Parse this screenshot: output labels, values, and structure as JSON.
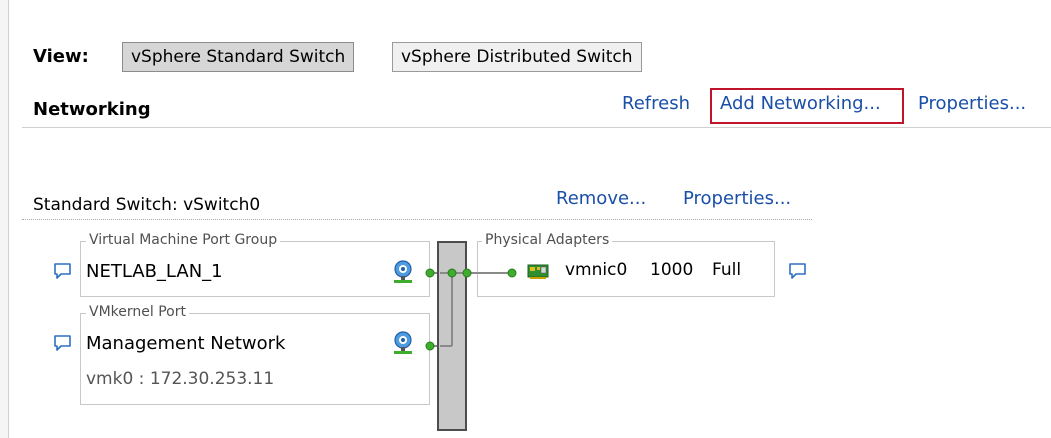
{
  "view": {
    "label": "View:",
    "buttons": [
      {
        "label": "vSphere Standard Switch",
        "active": true
      },
      {
        "label": "vSphere Distributed Switch",
        "active": false
      }
    ]
  },
  "networking": {
    "title": "Networking",
    "links": {
      "refresh": "Refresh",
      "add_networking": "Add Networking...",
      "properties": "Properties..."
    }
  },
  "standard_switch": {
    "title": "Standard Switch: vSwitch0",
    "links": {
      "remove": "Remove...",
      "properties": "Properties..."
    },
    "vm_port_group": {
      "legend": "Virtual Machine Port Group",
      "name": "NETLAB_LAN_1"
    },
    "vmkernel_port": {
      "legend": "VMkernel Port",
      "name": "Management Network",
      "detail": "vmk0 : 172.30.253.11"
    },
    "physical_adapters": {
      "legend": "Physical Adapters",
      "adapter": {
        "name": "vmnic0",
        "speed": "1000",
        "duplex": "Full"
      }
    }
  },
  "colors": {
    "link": "#1a4fa8",
    "highlight_box": "#c0142b",
    "connector_green": "#3cae2c",
    "line_gray": "#8a8a8a"
  },
  "icons": [
    "speech-bubble-icon",
    "network-globe-icon",
    "nic-card-icon"
  ]
}
